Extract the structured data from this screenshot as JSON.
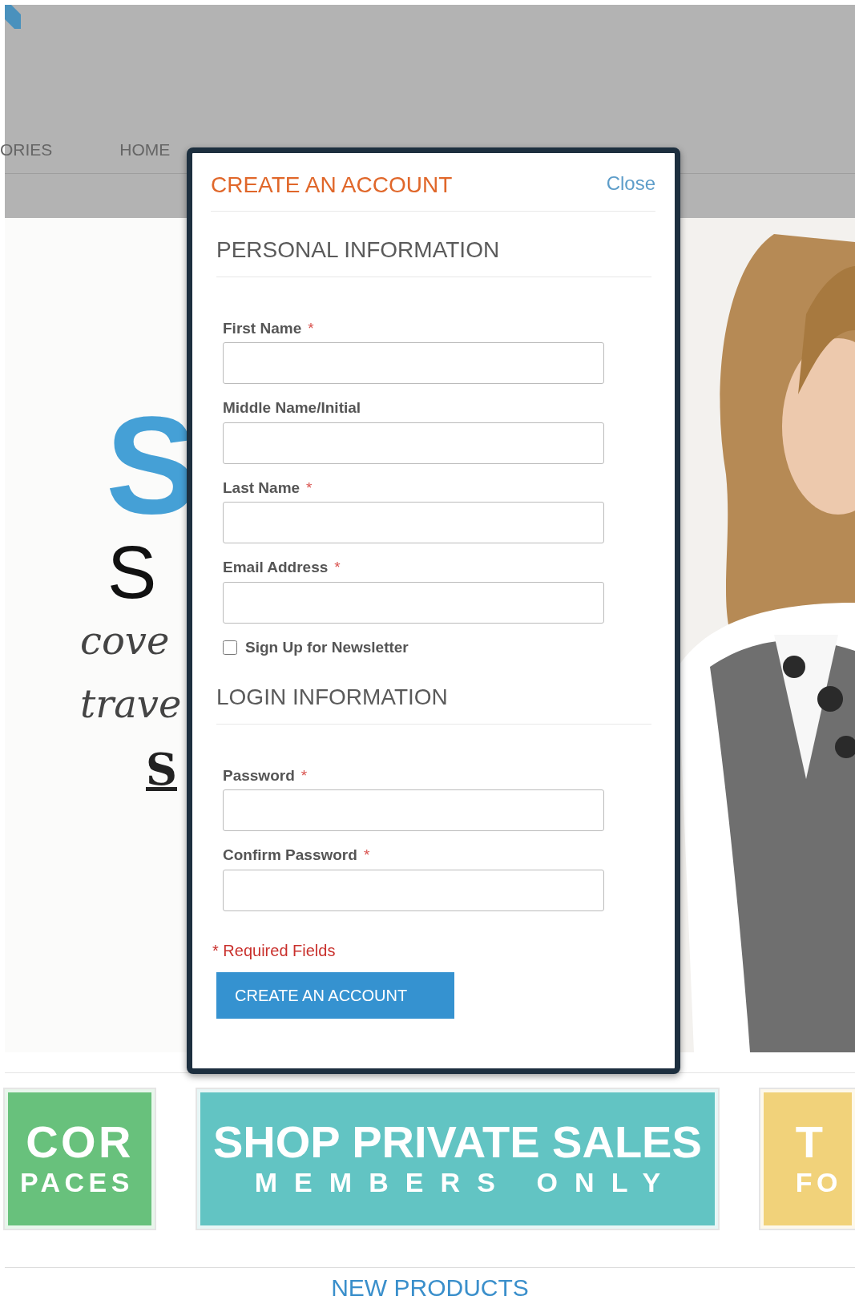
{
  "header": {
    "nav": [
      {
        "label": "ORIES"
      },
      {
        "label": "HOME"
      }
    ]
  },
  "hero": {
    "lines": [
      {
        "kind": "big",
        "text": "S"
      },
      {
        "kind": "display",
        "text": "S"
      },
      {
        "kind": "script",
        "text": "cove"
      },
      {
        "kind": "script",
        "text": "trave"
      },
      {
        "kind": "link",
        "text": "S"
      }
    ]
  },
  "modal": {
    "title": "CREATE AN ACCOUNT",
    "close": "Close",
    "sections": [
      {
        "heading": "PERSONAL INFORMATION",
        "fields": [
          {
            "kind": "text",
            "label": "First Name",
            "required_mark": "*"
          },
          {
            "kind": "text",
            "label": "Middle Name/Initial"
          },
          {
            "kind": "text",
            "label": "Last Name",
            "required_mark": "*"
          },
          {
            "kind": "text",
            "label": "Email Address",
            "required_mark": "*"
          },
          {
            "kind": "checkbox",
            "label": "Sign Up for Newsletter",
            "checked": false
          }
        ]
      },
      {
        "heading": "LOGIN INFORMATION",
        "fields": [
          {
            "kind": "password",
            "label": "Password",
            "required_mark": "*"
          },
          {
            "kind": "password",
            "label": "Confirm Password",
            "required_mark": "*"
          }
        ]
      }
    ],
    "required_note": "* Required Fields",
    "submit": "CREATE AN ACCOUNT"
  },
  "banners": [
    {
      "kind": "cut_left",
      "color": "#68c17c",
      "lines": [
        "COR",
        "PACES"
      ]
    },
    {
      "kind": "full",
      "color": "#62c4c3",
      "lines": [
        "SHOP PRIVATE SALES",
        "MEMBERS ONLY"
      ]
    },
    {
      "kind": "cut_right",
      "color": "#f1d27a",
      "lines": [
        "T",
        "FO"
      ]
    }
  ],
  "section_title": "NEW PRODUCTS"
}
